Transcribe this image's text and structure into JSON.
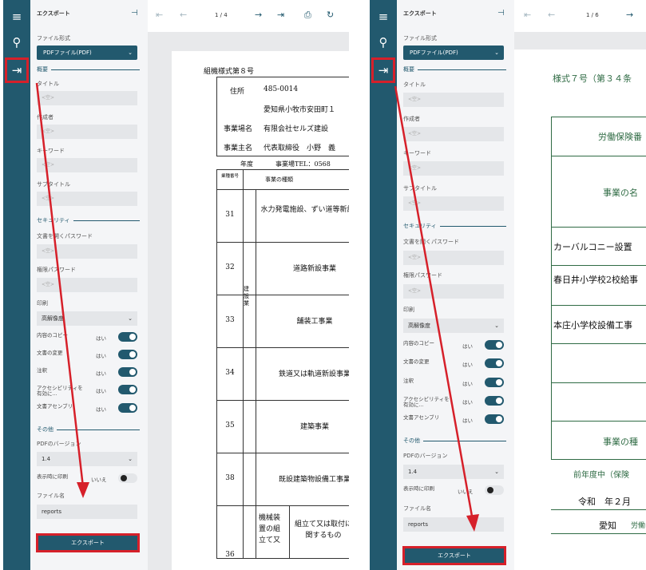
{
  "left": {
    "export_header": "エクスポート",
    "page_indicator": "1 / 4",
    "file_format_label": "ファイル形式",
    "file_format_value": "PDFファイル(PDF)",
    "section_summary": "概要",
    "title_label": "タイトル",
    "author_label": "作成者",
    "keyword_label": "キーワード",
    "subtitle_label": "サブタイトル",
    "empty_placeholder": "<空>",
    "section_security": "セキュリティ",
    "open_password_label": "文書を開くパスワード",
    "permission_password_label": "権限パスワード",
    "print_label": "印刷",
    "print_value": "高解像度",
    "toggles": [
      {
        "label": "内容のコピー",
        "value": "はい"
      },
      {
        "label": "文書の変更",
        "value": "はい"
      },
      {
        "label": "注釈",
        "value": "はい"
      },
      {
        "label": "アクセシビリティを有効に...",
        "value": "はい"
      },
      {
        "label": "文書アセンブリ",
        "value": "はい"
      }
    ],
    "section_other": "その他",
    "pdf_version_label": "PDFのバージョン",
    "pdf_version_value": "1.4",
    "print_on_display_label": "表示時に印刷",
    "print_on_display_value": "いいえ",
    "filename_label": "ファイル名",
    "filename_value": "reports",
    "export_button": "エクスポート",
    "doc": {
      "form_title": "組機様式第８号",
      "address_label": "住所",
      "postal": "485-0014",
      "address_line": "愛知県小牧市安田町１",
      "business_name_label": "事業場名",
      "business_name": "有限会社セルズ建設",
      "owner_label": "事業主名",
      "owner": "代表取締役　小野　義",
      "year_label": "年度",
      "tel": "事業場TEL：0568",
      "col_no": "業種番号",
      "col_type": "事業の種類",
      "vertical_group": "建設業",
      "rows": [
        {
          "no": "31",
          "name": "水力発電施設、ずい道等新設事業"
        },
        {
          "no": "32",
          "name": "道路新設事業"
        },
        {
          "no": "33",
          "name": "舗装工事業"
        },
        {
          "no": "34",
          "name": "鉄道又は軌道新設事業"
        },
        {
          "no": "35",
          "name": "建築事業"
        },
        {
          "no": "38",
          "name": "既設建築物設備工事業"
        },
        {
          "no": "36",
          "name": "機械装置の組立て又",
          "sub": "組立て又は取付に関するもの"
        }
      ]
    }
  },
  "right": {
    "export_header": "エクスポート",
    "page_indicator": "1 / 6",
    "file_format_label": "ファイル形式",
    "file_format_value": "PDFファイル(PDF)",
    "section_summary": "概要",
    "title_label": "タイトル",
    "author_label": "作成者",
    "keyword_label": "キーワード",
    "subtitle_label": "サブタイトル",
    "empty_placeholder": "<空>",
    "section_security": "セキュリティ",
    "open_password_label": "文書を開くパスワード",
    "permission_password_label": "権限パスワード",
    "print_label": "印刷",
    "print_value": "高解像度",
    "toggles": [
      {
        "label": "内容のコピー",
        "value": "はい"
      },
      {
        "label": "文書の変更",
        "value": "はい"
      },
      {
        "label": "注釈",
        "value": "はい"
      },
      {
        "label": "アクセシビリティを有効に...",
        "value": "はい"
      },
      {
        "label": "文書アセンブリ",
        "value": "はい"
      }
    ],
    "section_other": "その他",
    "pdf_version_label": "PDFのバージョン",
    "pdf_version_value": "1.4",
    "print_on_display_label": "表示時に印刷",
    "print_on_display_value": "いいえ",
    "filename_label": "ファイル名",
    "filename_value": "reports",
    "export_button": "エクスポート",
    "doc": {
      "form_title": "様式７号（第３４条",
      "cell1": "労働保険番",
      "cell2": "事業の名",
      "row1": "カーバルコニー設置",
      "row2": "春日井小学校2校給事",
      "row3": "本庄小学校設備工事",
      "cell3": "事業の種",
      "note": "前年度中（保険",
      "date": "令和　年２月",
      "sign": "愛知",
      "sign2": "労働"
    }
  },
  "colors": {
    "sidebar_dark": "#22596e",
    "highlight": "#d6202a",
    "toggle_on": "#22596e"
  }
}
